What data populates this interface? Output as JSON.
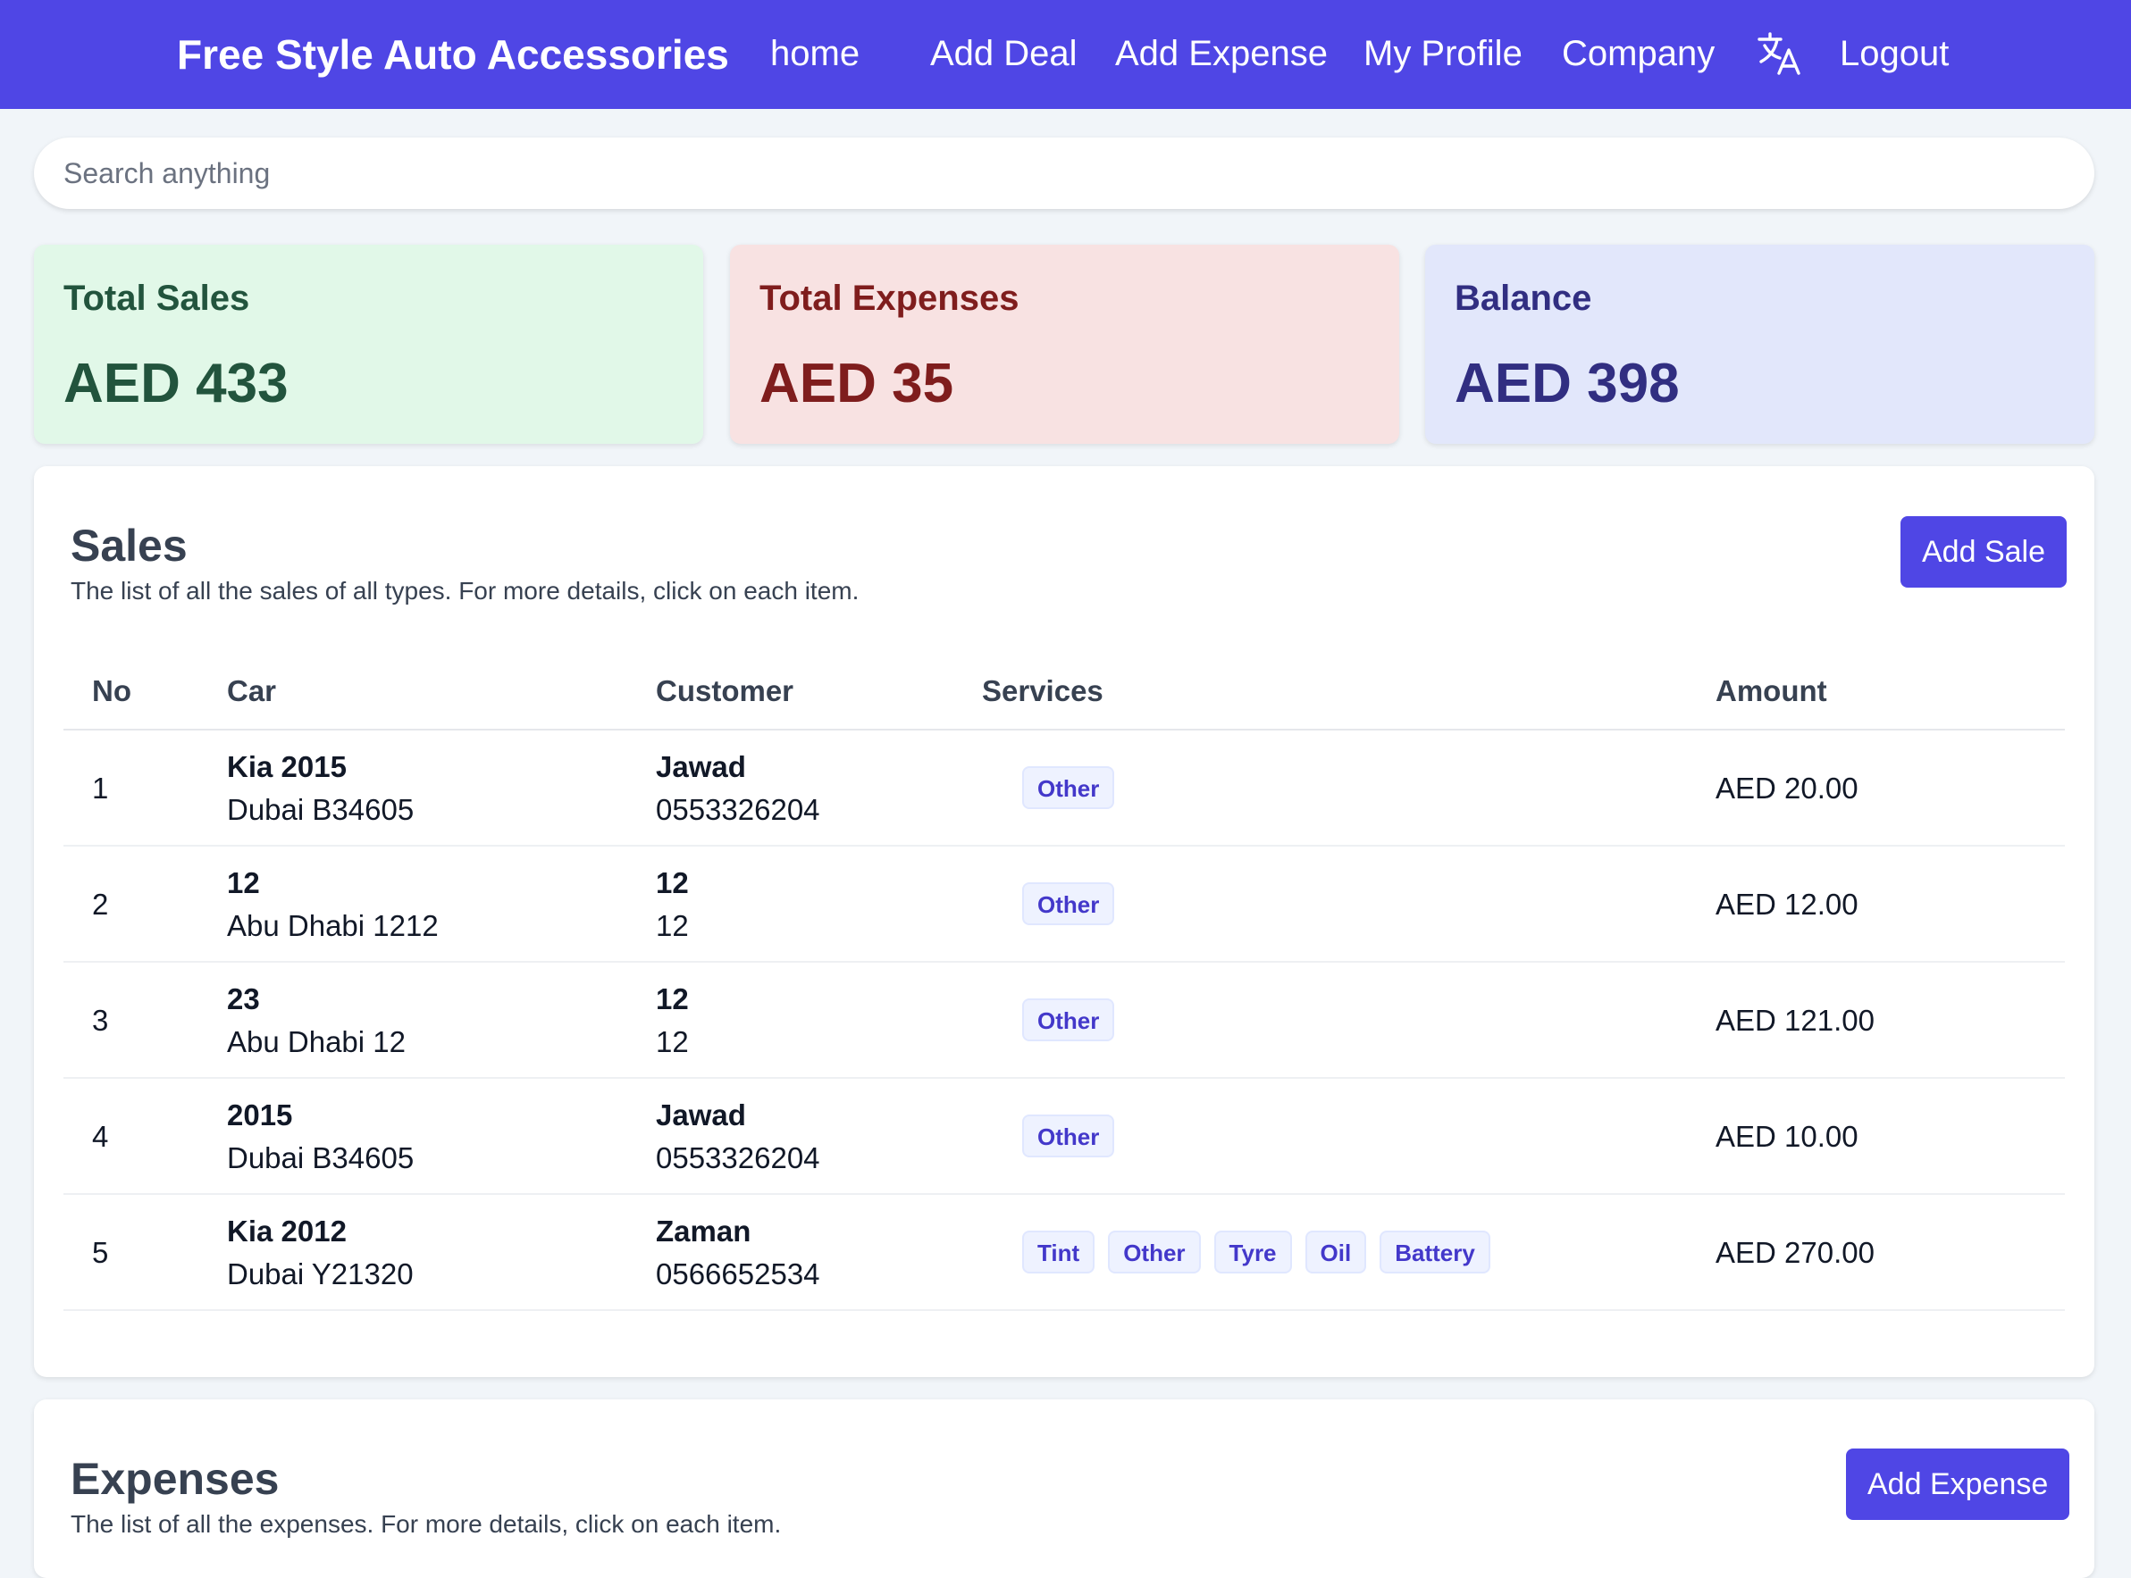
{
  "navbar": {
    "brand": "Free Style Auto Accessories",
    "links": [
      "home",
      "Add Deal",
      "Add Expense",
      "My Profile",
      "Company",
      "Logout"
    ],
    "translate_icon": "translate-icon"
  },
  "search": {
    "placeholder": "Search anything",
    "value": ""
  },
  "cards": [
    {
      "label": "Total Sales",
      "value": "AED 433",
      "bg": "#dcfce7",
      "color": "#14532d"
    },
    {
      "label": "Total Expenses",
      "value": "AED 35",
      "bg": "#fce7e7",
      "color": "#7f1d1d"
    },
    {
      "label": "Balance",
      "value": "AED 398",
      "bg": "#e0e7ff",
      "color": "#312e81"
    }
  ],
  "sales": {
    "title": "Sales",
    "subtitle": "The list of all the sales of all types. For more details, click on each item.",
    "add_button": "Add Sale",
    "columns": [
      "No",
      "Car",
      "Customer",
      "Services",
      "Amount"
    ],
    "rows": [
      {
        "no": "1",
        "car": "Kia 2015",
        "plate": "Dubai B34605",
        "customer": "Jawad",
        "phone": "0553326204",
        "services": [
          "Other"
        ],
        "amount": "AED 20.00"
      },
      {
        "no": "2",
        "car": "12",
        "plate": "Abu Dhabi 1212",
        "customer": "12",
        "phone": "12",
        "services": [
          "Other"
        ],
        "amount": "AED 12.00"
      },
      {
        "no": "3",
        "car": "23",
        "plate": "Abu Dhabi 12",
        "customer": "12",
        "phone": "12",
        "services": [
          "Other"
        ],
        "amount": "AED 121.00"
      },
      {
        "no": "4",
        "car": "2015",
        "plate": "Dubai B34605",
        "customer": "Jawad",
        "phone": "0553326204",
        "services": [
          "Other"
        ],
        "amount": "AED 10.00"
      },
      {
        "no": "5",
        "car": "Kia 2012",
        "plate": "Dubai Y21320",
        "customer": "Zaman",
        "phone": "0566652534",
        "services": [
          "Tint",
          "Other",
          "Tyre",
          "Oil",
          "Battery"
        ],
        "amount": "AED 270.00"
      }
    ]
  },
  "expenses": {
    "title": "Expenses",
    "subtitle": "The list of all the expenses. For more details, click on each item.",
    "add_button": "Add Expense"
  },
  "colors": {
    "accent": "#4f46e5",
    "background": "#f1f5f9"
  }
}
